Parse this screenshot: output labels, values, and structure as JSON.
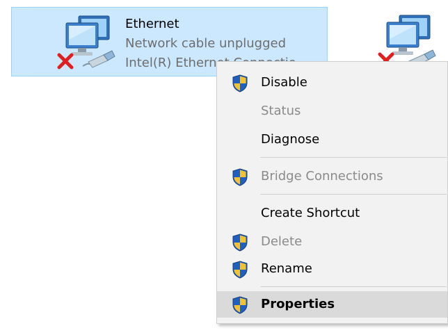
{
  "adapter": {
    "name": "Ethernet",
    "status": "Network cable unplugged",
    "device": "Intel(R) Ethernet Connectio",
    "status_icon": "red-x-disconnected-icon"
  },
  "context_menu": {
    "items": [
      {
        "label": "Disable",
        "icon": "uac-shield-icon",
        "enabled": true
      },
      {
        "label": "Status",
        "icon": null,
        "enabled": false
      },
      {
        "label": "Diagnose",
        "icon": null,
        "enabled": true
      },
      {
        "label": "Bridge Connections",
        "icon": "uac-shield-icon",
        "enabled": false
      },
      {
        "label": "Create Shortcut",
        "icon": null,
        "enabled": true
      },
      {
        "label": "Delete",
        "icon": "uac-shield-icon",
        "enabled": false
      },
      {
        "label": "Rename",
        "icon": "uac-shield-icon",
        "enabled": true
      },
      {
        "label": "Properties",
        "icon": "uac-shield-icon",
        "enabled": true,
        "highlighted": true,
        "bold": true
      }
    ]
  },
  "colors": {
    "selection": "#cce8ff",
    "menu_bg": "#f2f2f2",
    "menu_hover": "#dadada",
    "disabled_text": "#8a8a8a"
  }
}
